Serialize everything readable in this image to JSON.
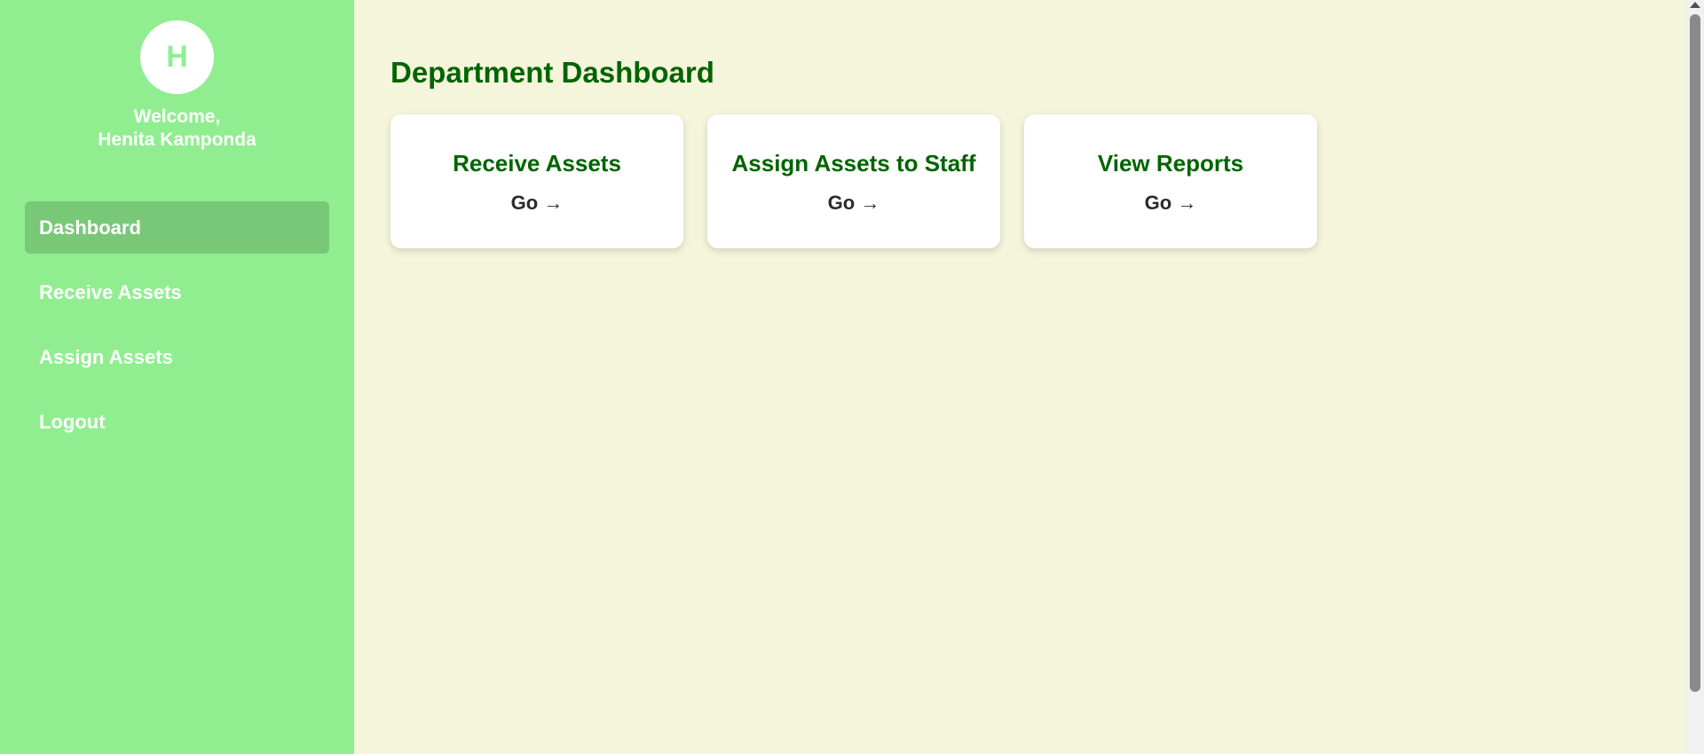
{
  "sidebar": {
    "avatar_initial": "H",
    "welcome_line1": "Welcome,",
    "welcome_line2": "Henita Kamponda",
    "items": [
      {
        "label": "Dashboard",
        "active": true
      },
      {
        "label": "Receive Assets",
        "active": false
      },
      {
        "label": "Assign Assets",
        "active": false
      },
      {
        "label": "Logout",
        "active": false
      }
    ]
  },
  "main": {
    "title": "Department Dashboard",
    "cards": [
      {
        "title": "Receive Assets",
        "link": "Go →"
      },
      {
        "title": "Assign Assets to Staff",
        "link": "Go →"
      },
      {
        "title": "View Reports",
        "link": "Go →"
      }
    ]
  },
  "colors": {
    "sidebar_bg": "#90ee90",
    "sidebar_active": "#78c878",
    "main_bg": "#f5f5dc",
    "accent_green": "#006400"
  },
  "icons": {
    "scroll_up": "chevron-up-icon"
  }
}
